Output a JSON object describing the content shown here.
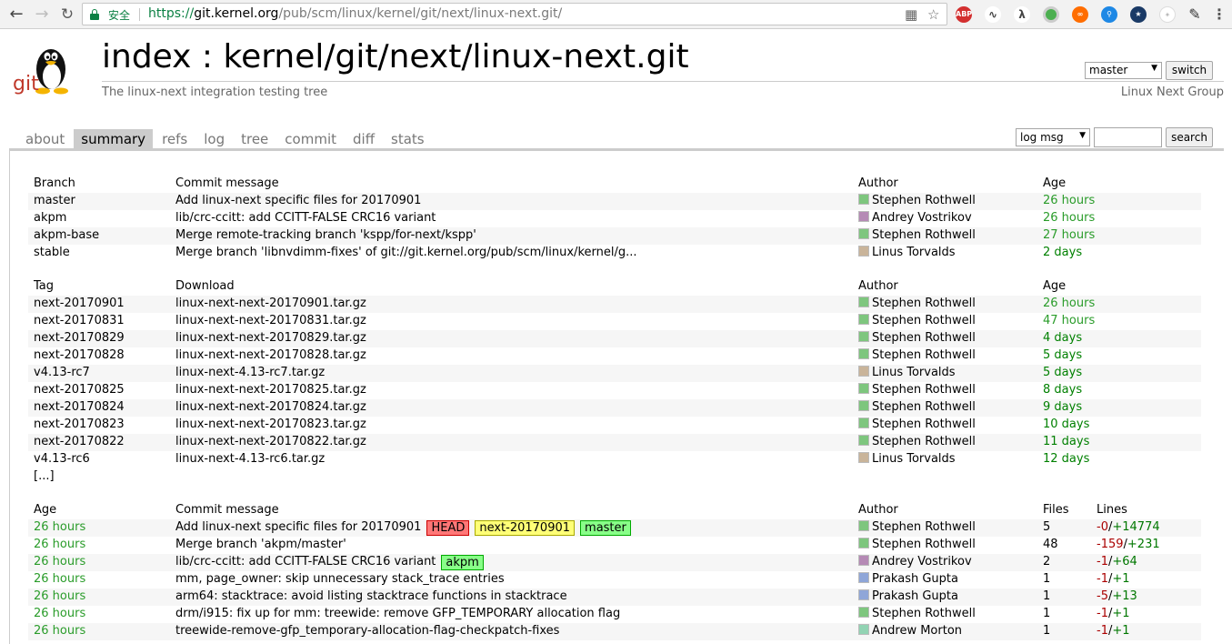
{
  "browser": {
    "secure_label": "安全",
    "url_scheme": "https://",
    "url_host": "git.kernel.org",
    "url_path": "/pub/scm/linux/kernel/git/next/linux-next.git/"
  },
  "header": {
    "logo_text": "git",
    "title": "index : kernel/git/next/linux-next.git",
    "description": "The linux-next integration testing tree",
    "owner": "Linux Next Group",
    "branch_selected": "master",
    "switch_label": "switch"
  },
  "tabs": [
    "about",
    "summary",
    "refs",
    "log",
    "tree",
    "commit",
    "diff",
    "stats"
  ],
  "search": {
    "grep_selected": "log msg",
    "button_label": "search"
  },
  "branches": {
    "headers": [
      "Branch",
      "Commit message",
      "Author",
      "Age"
    ],
    "rows": [
      {
        "name": "master",
        "message": "Add linux-next specific files for 20170901",
        "author": "Stephen Rothwell",
        "avatar": "green",
        "age": "26 hours",
        "recent": true
      },
      {
        "name": "akpm",
        "message": "lib/crc-ccitt: add CCITT-FALSE CRC16 variant",
        "author": "Andrey Vostrikov",
        "avatar": "purple",
        "age": "26 hours",
        "recent": true
      },
      {
        "name": "akpm-base",
        "message": "Merge remote-tracking branch 'kspp/for-next/kspp'",
        "author": "Stephen Rothwell",
        "avatar": "green",
        "age": "27 hours",
        "recent": true
      },
      {
        "name": "stable",
        "message": "Merge branch 'libnvdimm-fixes' of git://git.kernel.org/pub/scm/linux/kernel/g...",
        "author": "Linus Torvalds",
        "avatar": "tan",
        "age": "2 days",
        "recent": false
      }
    ]
  },
  "tags": {
    "headers": [
      "Tag",
      "Download",
      "Author",
      "Age"
    ],
    "rows": [
      {
        "name": "next-20170901",
        "download": "linux-next-next-20170901.tar.gz",
        "author": "Stephen Rothwell",
        "avatar": "green",
        "age": "26 hours",
        "recent": true
      },
      {
        "name": "next-20170831",
        "download": "linux-next-next-20170831.tar.gz",
        "author": "Stephen Rothwell",
        "avatar": "green",
        "age": "47 hours",
        "recent": true
      },
      {
        "name": "next-20170829",
        "download": "linux-next-next-20170829.tar.gz",
        "author": "Stephen Rothwell",
        "avatar": "green",
        "age": "4 days",
        "recent": false
      },
      {
        "name": "next-20170828",
        "download": "linux-next-next-20170828.tar.gz",
        "author": "Stephen Rothwell",
        "avatar": "green",
        "age": "5 days",
        "recent": false
      },
      {
        "name": "v4.13-rc7",
        "download": "linux-next-4.13-rc7.tar.gz",
        "author": "Linus Torvalds",
        "avatar": "tan",
        "age": "5 days",
        "recent": false
      },
      {
        "name": "next-20170825",
        "download": "linux-next-next-20170825.tar.gz",
        "author": "Stephen Rothwell",
        "avatar": "green",
        "age": "8 days",
        "recent": false
      },
      {
        "name": "next-20170824",
        "download": "linux-next-next-20170824.tar.gz",
        "author": "Stephen Rothwell",
        "avatar": "green",
        "age": "9 days",
        "recent": false
      },
      {
        "name": "next-20170823",
        "download": "linux-next-next-20170823.tar.gz",
        "author": "Stephen Rothwell",
        "avatar": "green",
        "age": "10 days",
        "recent": false
      },
      {
        "name": "next-20170822",
        "download": "linux-next-next-20170822.tar.gz",
        "author": "Stephen Rothwell",
        "avatar": "green",
        "age": "11 days",
        "recent": false
      },
      {
        "name": "v4.13-rc6",
        "download": "linux-next-4.13-rc6.tar.gz",
        "author": "Linus Torvalds",
        "avatar": "tan",
        "age": "12 days",
        "recent": false
      }
    ],
    "more": "[...]"
  },
  "commits": {
    "headers": [
      "Age",
      "Commit message",
      "Author",
      "Files",
      "Lines"
    ],
    "rows": [
      {
        "age": "26 hours",
        "message": "Add linux-next specific files for 20170901",
        "decorations": [
          {
            "type": "head",
            "label": "HEAD"
          },
          {
            "type": "tag",
            "label": "next-20170901"
          },
          {
            "type": "branch",
            "label": "master"
          }
        ],
        "author": "Stephen Rothwell",
        "avatar": "green",
        "files": "5",
        "del": "-0",
        "add": "+14774"
      },
      {
        "age": "26 hours",
        "message": "Merge branch 'akpm/master'",
        "decorations": [],
        "author": "Stephen Rothwell",
        "avatar": "green",
        "files": "48",
        "del": "-159",
        "add": "+231"
      },
      {
        "age": "26 hours",
        "message": "lib/crc-ccitt: add CCITT-FALSE CRC16 variant",
        "decorations": [
          {
            "type": "branch",
            "label": "akpm"
          }
        ],
        "author": "Andrey Vostrikov",
        "avatar": "purple",
        "files": "2",
        "del": "-1",
        "add": "+64"
      },
      {
        "age": "26 hours",
        "message": "mm, page_owner: skip unnecessary stack_trace entries",
        "decorations": [],
        "author": "Prakash Gupta",
        "avatar": "blue",
        "files": "1",
        "del": "-1",
        "add": "+1"
      },
      {
        "age": "26 hours",
        "message": "arm64: stacktrace: avoid listing stacktrace functions in stacktrace",
        "decorations": [],
        "author": "Prakash Gupta",
        "avatar": "blue",
        "files": "1",
        "del": "-5",
        "add": "+13"
      },
      {
        "age": "26 hours",
        "message": "drm/i915: fix up for mm: treewide: remove GFP_TEMPORARY allocation flag",
        "decorations": [],
        "author": "Stephen Rothwell",
        "avatar": "green",
        "files": "1",
        "del": "-1",
        "add": "+1"
      },
      {
        "age": "26 hours",
        "message": "treewide-remove-gfp_temporary-allocation-flag-checkpatch-fixes",
        "decorations": [],
        "author": "Andrew Morton",
        "avatar": "mint",
        "files": "1",
        "del": "-1",
        "add": "+1"
      }
    ]
  }
}
